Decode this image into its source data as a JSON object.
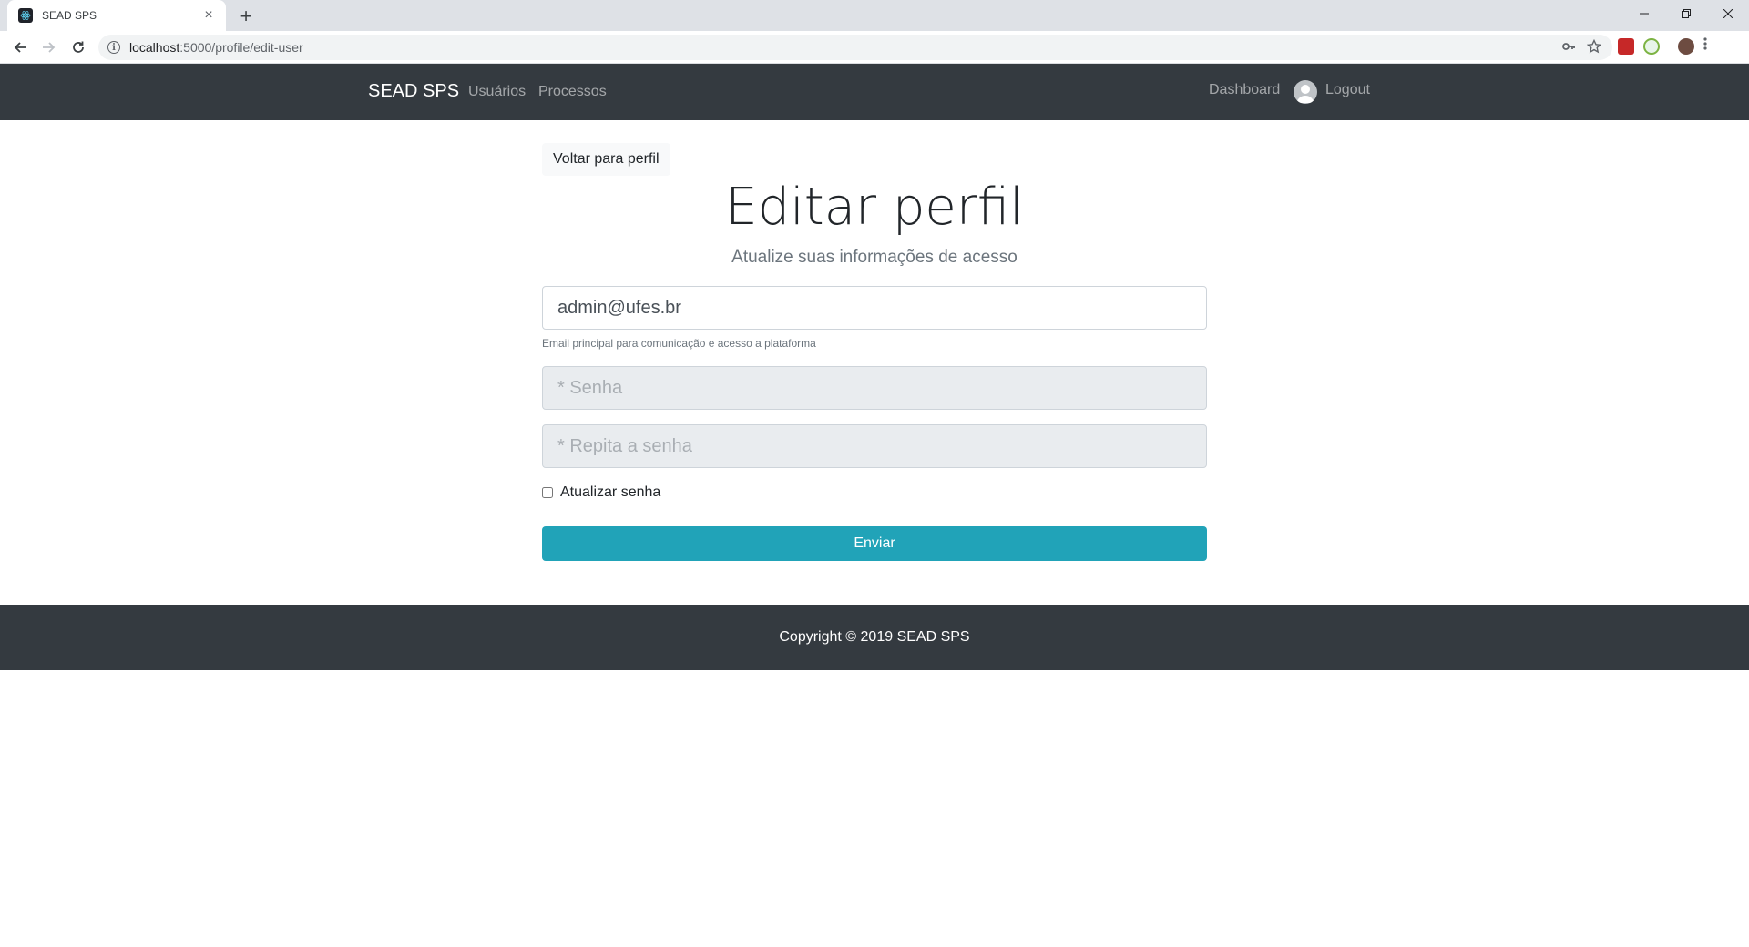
{
  "browser": {
    "tab_title": "SEAD SPS",
    "url_host": "localhost",
    "url_path": ":5000/profile/edit-user",
    "new_tab": "+",
    "tab_close": "×"
  },
  "navbar": {
    "brand": "SEAD SPS",
    "links": [
      "Usuários",
      "Processos"
    ],
    "right_links": [
      "Dashboard",
      "Logout"
    ]
  },
  "page": {
    "back_button": "Voltar para perfil",
    "title": "Editar perfil",
    "subtitle": "Atualize suas informações de acesso",
    "email_value": "admin@ufes.br",
    "email_help": "Email principal para comunicação e acesso a plataforma",
    "password_placeholder": "* Senha",
    "repeat_password_placeholder": "* Repita a senha",
    "update_password_label": "Atualizar senha",
    "update_password_checked": false,
    "submit_button": "Enviar"
  },
  "footer": {
    "copyright": "Copyright © 2019 SEAD SPS"
  },
  "colors": {
    "navbar_bg": "#343a40",
    "accent_button": "#21a3b8",
    "footer_bg": "#343a40"
  }
}
